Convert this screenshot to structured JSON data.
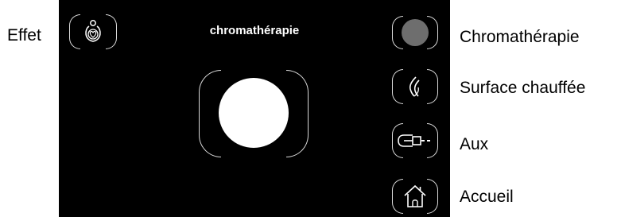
{
  "callouts": {
    "effet": "Effet",
    "chromatherapie": "Chromathérapie",
    "surface_chauffee": "Surface chauffée",
    "aux": "Aux",
    "accueil": "Accueil"
  },
  "screen": {
    "title": "chromathérapie",
    "current_color": "#ffffff"
  },
  "side_buttons": [
    {
      "name": "chromatherapie",
      "icon": "grey-circle-icon",
      "color": "#6e6e6e"
    },
    {
      "name": "heated-surface",
      "icon": "flame-icon"
    },
    {
      "name": "aux",
      "icon": "aux-plug-icon"
    },
    {
      "name": "home",
      "icon": "house-icon"
    }
  ],
  "effet_button": {
    "icon": "effect-drop-icon"
  },
  "colors": {
    "screen_bg": "#000000",
    "outline": "#d9d9d9",
    "page_bg": "#ffffff",
    "text": "#000000"
  }
}
